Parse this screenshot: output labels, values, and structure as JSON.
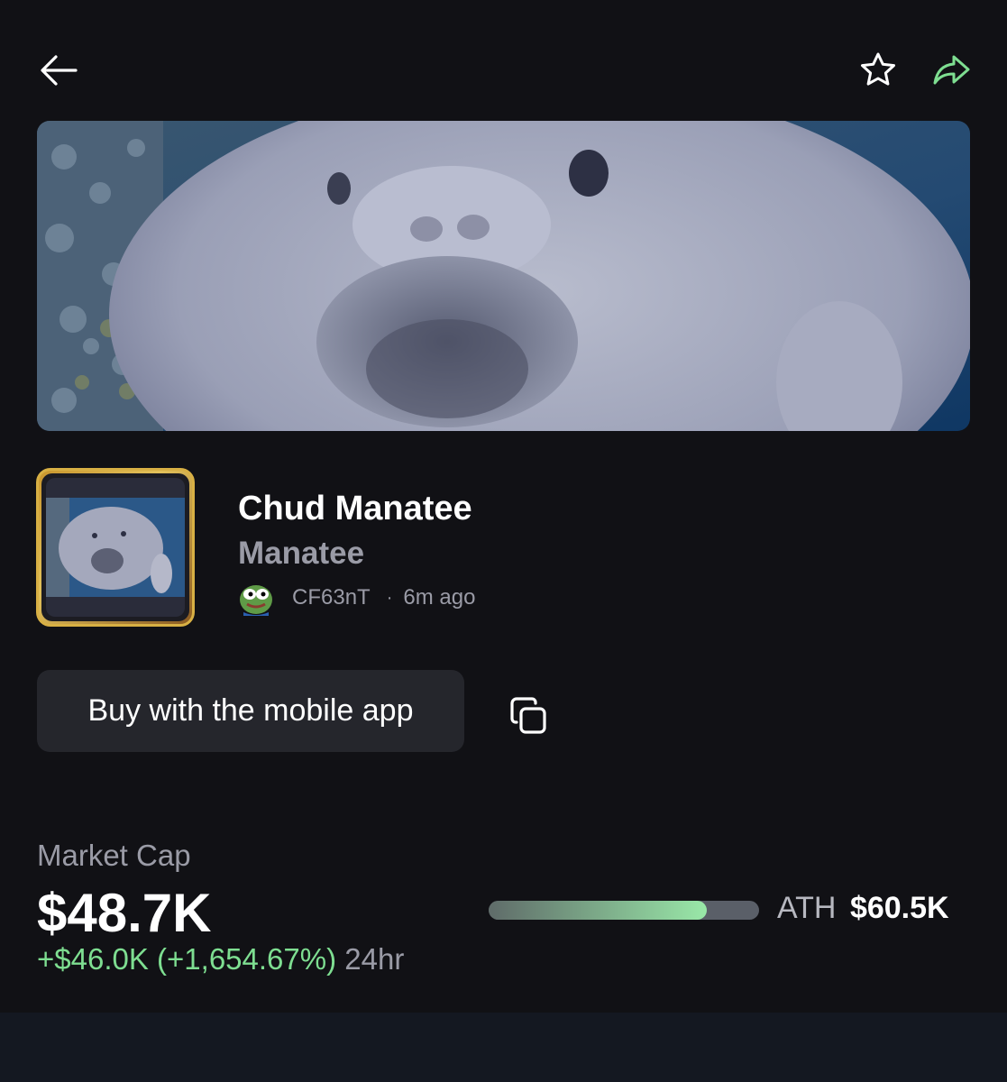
{
  "icons": {
    "back": "arrow-left-icon",
    "favorite": "star-outline-icon",
    "share": "share-arrow-icon",
    "copy": "copy-icon",
    "creator_avatar": "pepe-frog-avatar"
  },
  "colors": {
    "background": "#111115",
    "accent_green": "#7ede91",
    "muted_text": "#9a9ba6",
    "thumb_border": "#d8b044",
    "button_bg": "#25262c"
  },
  "token": {
    "name": "Chud Manatee",
    "ticker": "Manatee",
    "creator": "CF63nT",
    "separator": "·",
    "age": "6m ago"
  },
  "actions": {
    "buy_label": "Buy with the mobile app"
  },
  "market": {
    "label": "Market Cap",
    "value": "$48.7K",
    "change": "+$46.0K (+1,654.67%)",
    "period": "24hr",
    "ath_label": "ATH",
    "ath_value": "$60.5K",
    "progress_fraction": 0.805
  }
}
